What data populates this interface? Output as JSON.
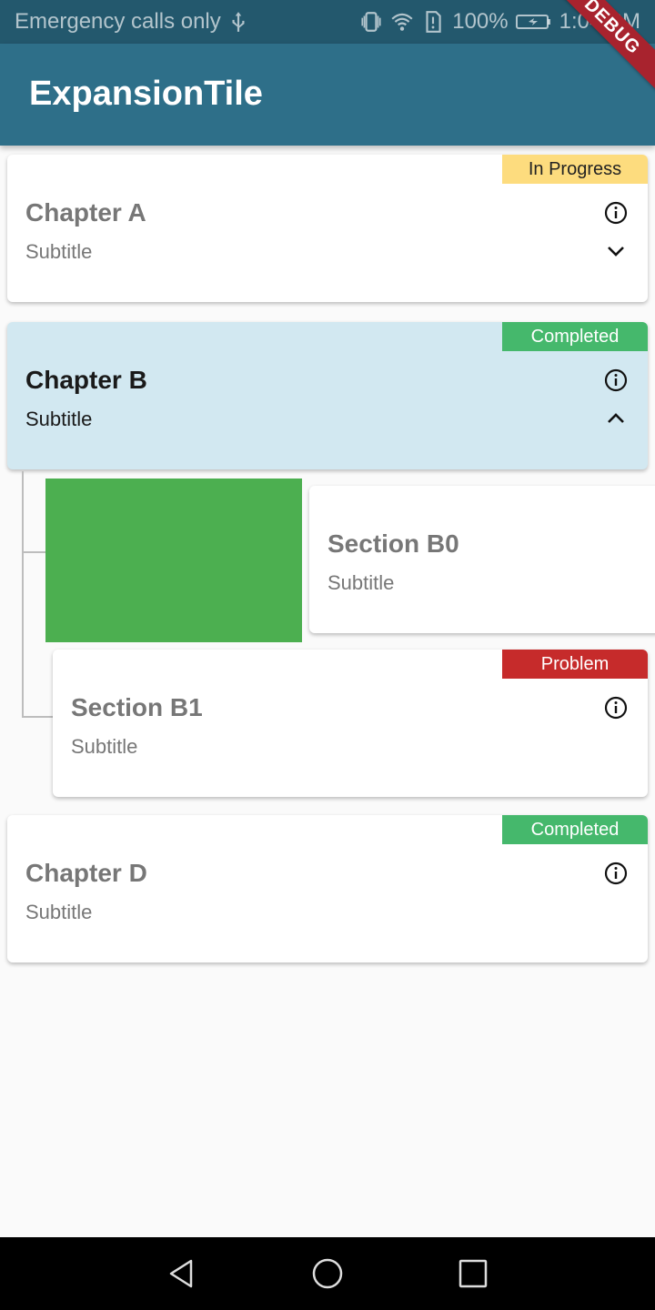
{
  "status_bar": {
    "carrier_text": "Emergency calls only",
    "battery_percent": "100%",
    "time": "1:04 PM",
    "icons": [
      "usb-icon",
      "vibrate-icon",
      "wifi-icon",
      "sim-alert-icon",
      "battery-charging-icon"
    ]
  },
  "app_bar": {
    "title": "ExpansionTile",
    "debug_label": "DEBUG"
  },
  "chapters": [
    {
      "title": "Chapter A",
      "subtitle": "Subtitle",
      "status": "In Progress",
      "expanded": false
    },
    {
      "title": "Chapter B",
      "subtitle": "Subtitle",
      "status": "Completed",
      "expanded": true
    },
    {
      "title": "Chapter D",
      "subtitle": "Subtitle",
      "status": "Completed",
      "expanded": false
    }
  ],
  "sections": [
    {
      "title": "Section B0",
      "subtitle": "Subtitle",
      "status": ""
    },
    {
      "title": "Section B1",
      "subtitle": "Subtitle",
      "status": "Problem"
    }
  ],
  "colors": {
    "status_bar": "#23586d",
    "app_bar": "#2e6f89",
    "selected_card": "#d2e8f1",
    "in_progress": "#fddc7e",
    "completed": "#45b86c",
    "problem": "#c62b2b",
    "green_block": "#4caf50"
  }
}
